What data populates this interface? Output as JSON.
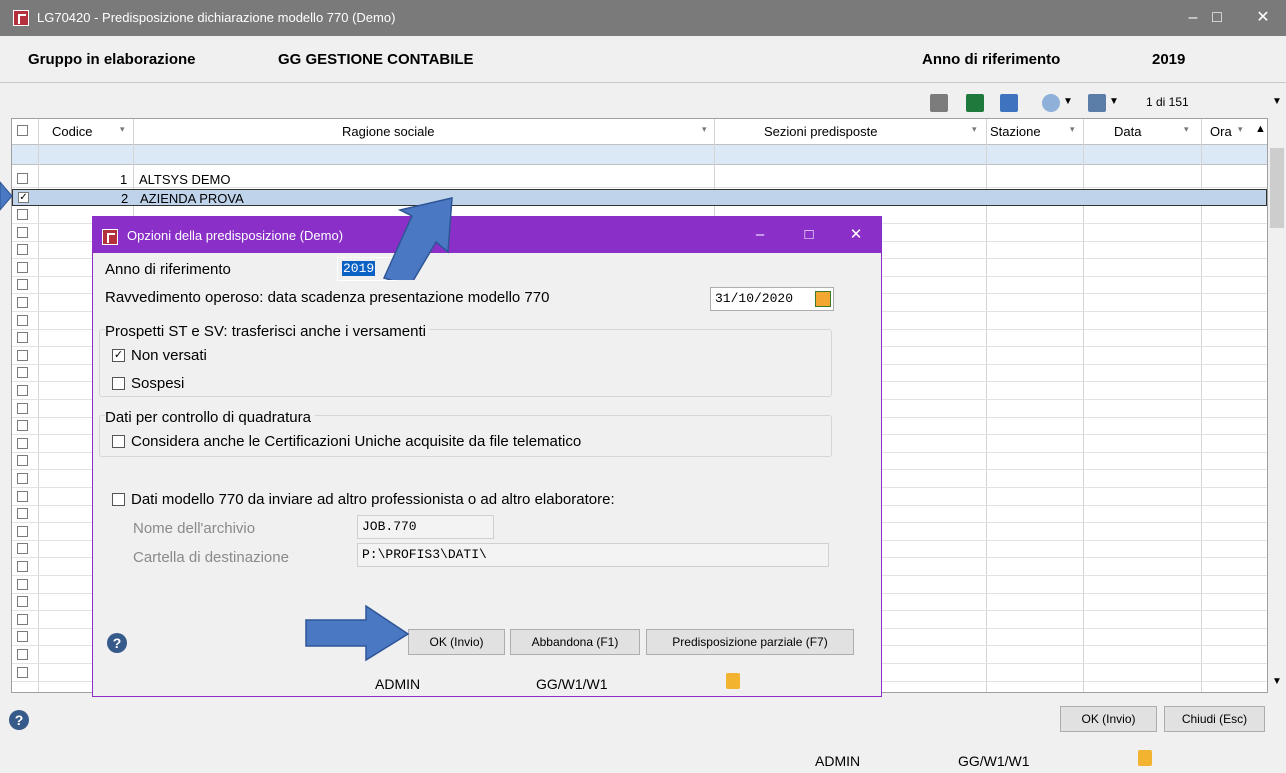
{
  "window": {
    "title": "LG70420 - Predisposizione dichiarazione modello 770  (Demo)",
    "minimize": "–",
    "maximize": "□",
    "close": "✕"
  },
  "group": {
    "label": "Gruppo in elaborazione",
    "value": "GG GESTIONE CONTABILE",
    "year_label": "Anno di riferimento",
    "year_value": "2019"
  },
  "toolbar": {
    "pager": "1 di 151"
  },
  "grid": {
    "columns": [
      "Codice",
      "Ragione sociale",
      "Sezioni predisposte",
      "Stazione",
      "Data",
      "Ora"
    ],
    "rows": [
      {
        "code": "1",
        "name": "ALTSYS DEMO",
        "checked": false
      },
      {
        "code": "2",
        "name": "AZIENDA PROVA",
        "checked": true
      }
    ]
  },
  "main_footer": {
    "ok": "OK (Invio)",
    "close": "Chiudi (Esc)",
    "user": "ADMIN",
    "station": "GG/W1/W1",
    "help": "?"
  },
  "dialog": {
    "title": "Opzioni della predisposizione  (Demo)",
    "year_label": "Anno di riferimento",
    "year_value": "2019",
    "ravv_label": "Ravvedimento operoso: data scadenza presentazione modello 770",
    "ravv_value": "31/10/2020",
    "group1_title": "Prospetti ST e SV: trasferisci anche i versamenti",
    "nonversati": "Non versati",
    "sospesi": "Sospesi",
    "group2_title": "Dati per controllo di quadratura",
    "cu_label": "Considera anche le Certificazioni Uniche acquisite da file telematico",
    "altro_label": "Dati modello 770 da inviare ad altro professionista o ad altro elaboratore:",
    "archivio_label": "Nome dell'archivio",
    "archivio_value": "JOB.770",
    "cartella_label": "Cartella di destinazione",
    "cartella_value": "P:\\PROFIS3\\DATI\\",
    "ok": "OK (Invio)",
    "abbandona": "Abbandona (F1)",
    "parziale": "Predisposizione parziale (F7)",
    "user": "ADMIN",
    "station": "GG/W1/W1",
    "help": "?",
    "checkmark": "✓"
  },
  "colors": {
    "dialog_accent": "#8b2fc9",
    "selection": "#0b62c4",
    "arrow": "#4a78c2"
  }
}
